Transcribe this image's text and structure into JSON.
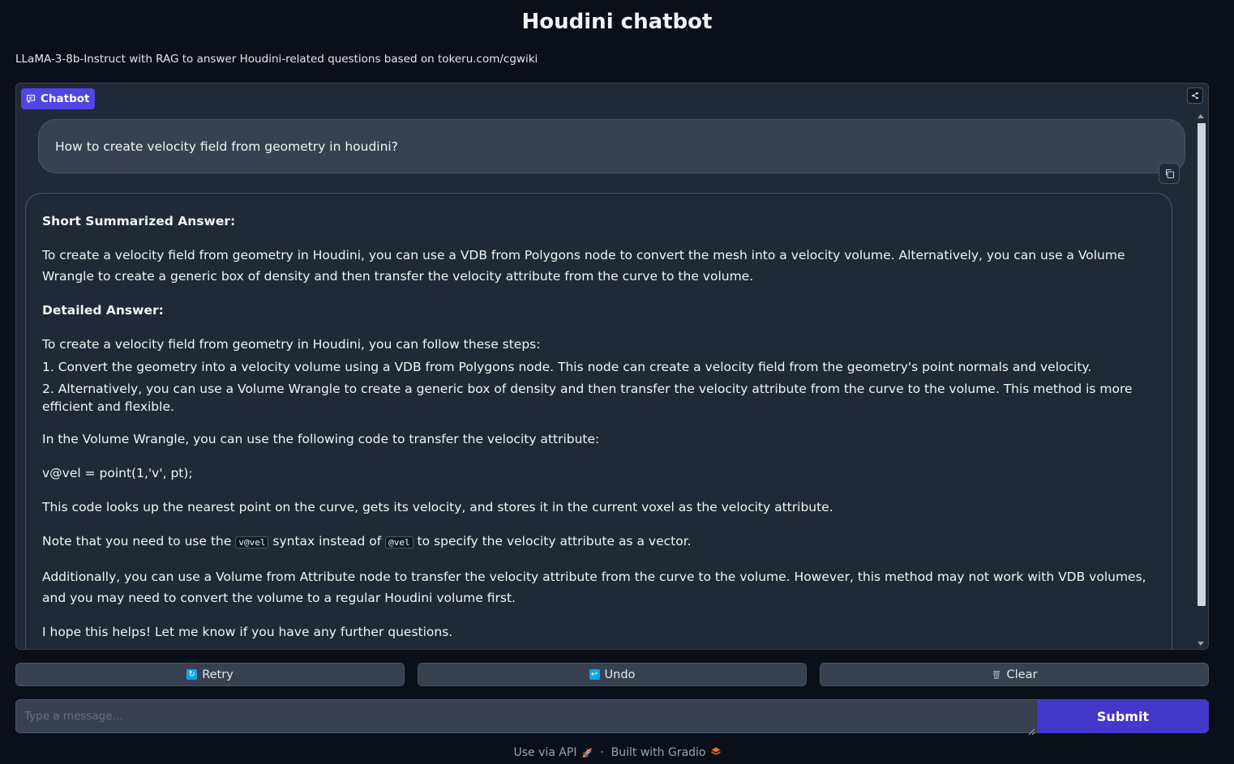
{
  "header": {
    "title": "Houdini chatbot",
    "description": "LLaMA-3-8b-Instruct with RAG to answer Houdini-related questions based on tokeru.com/cgwiki"
  },
  "chatbot": {
    "label": "Chatbot",
    "user_message": "How to create velocity field from geometry in houdini?",
    "bot_message": {
      "summary_heading": "Short Summarized Answer:",
      "summary_text": "To create a velocity field from geometry in Houdini, you can use a VDB from Polygons node to convert the mesh into a velocity volume. Alternatively, you can use a Volume Wrangle to create a generic box of density and then transfer the velocity attribute from the curve to the volume.",
      "detailed_heading": "Detailed Answer:",
      "steps_intro": "To create a velocity field from geometry in Houdini, you can follow these steps:",
      "step_1": "1. Convert the geometry into a velocity volume using a VDB from Polygons node. This node can create a velocity field from the geometry's point normals and velocity.",
      "step_2": "2. Alternatively, you can use a Volume Wrangle to create a generic box of density and then transfer the velocity attribute from the curve to the volume. This method is more efficient and flexible.",
      "wrangle_intro": "In the Volume Wrangle, you can use the following code to transfer the velocity attribute:",
      "code_line": "v@vel = point(1,'v', pt);",
      "code_explain": "This code looks up the nearest point on the curve, gets its velocity, and stores it in the current voxel as the velocity attribute.",
      "note_prefix": "Note that you need to use the",
      "note_code_1": "v@vel",
      "note_middle": "syntax instead of",
      "note_code_2": "@vel",
      "note_suffix": "to specify the velocity attribute as a vector.",
      "additional": "Additionally, you can use a Volume from Attribute node to transfer the velocity attribute from the curve to the volume. However, this method may not work with VDB volumes, and you may need to convert the volume to a regular Houdini volume first.",
      "closing": "I hope this helps! Let me know if you have any further questions."
    }
  },
  "actions": {
    "retry_label": "Retry",
    "retry_icon": "retry-icon",
    "undo_label": "Undo",
    "undo_icon": "undo-icon",
    "clear_label": "Clear",
    "clear_icon": "wastebasket-icon"
  },
  "input": {
    "placeholder": "Type a message...",
    "value": ""
  },
  "submit_label": "Submit",
  "footer": {
    "api_link": "Use via API",
    "separator": "·",
    "built_with": "Built with Gradio"
  },
  "colors": {
    "background": "#0b0f19",
    "panel": "#1f2937",
    "accent": "#4f46e5",
    "submit": "#4338ca"
  }
}
